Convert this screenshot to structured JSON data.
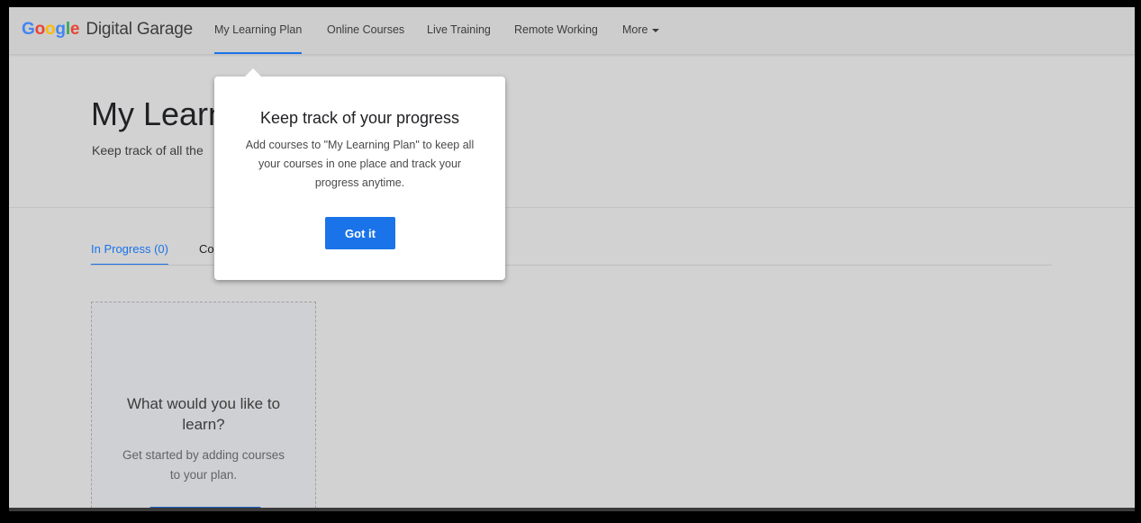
{
  "header": {
    "logo": {
      "brand_letters": [
        "G",
        "o",
        "o",
        "g",
        "l",
        "e"
      ],
      "product": "Digital Garage"
    },
    "nav": [
      {
        "label": "My Learning Plan",
        "active": true
      },
      {
        "label": "Online Courses",
        "active": false
      },
      {
        "label": "Live Training",
        "active": false
      },
      {
        "label": "Remote Working",
        "active": false
      },
      {
        "label": "More",
        "active": false
      }
    ],
    "more_icon": "caret-down-icon"
  },
  "hero": {
    "title": "My Learn",
    "subtitle": "Keep track of all the"
  },
  "tabs": [
    {
      "label": "In Progress (0)",
      "active": true
    },
    {
      "label": "Co",
      "active": false
    }
  ],
  "empty_card": {
    "title": "What would you like to learn?",
    "text": "Get started by adding courses to your plan."
  },
  "popover": {
    "title": "Keep track of your progress",
    "body": "Add courses to \"My Learning Plan\" to keep all your courses in one place and track your progress anytime.",
    "button": "Got it"
  },
  "colors": {
    "accent": "#1a73e8",
    "overlay_background": "#d2d2d2",
    "popover_background": "#ffffff"
  }
}
